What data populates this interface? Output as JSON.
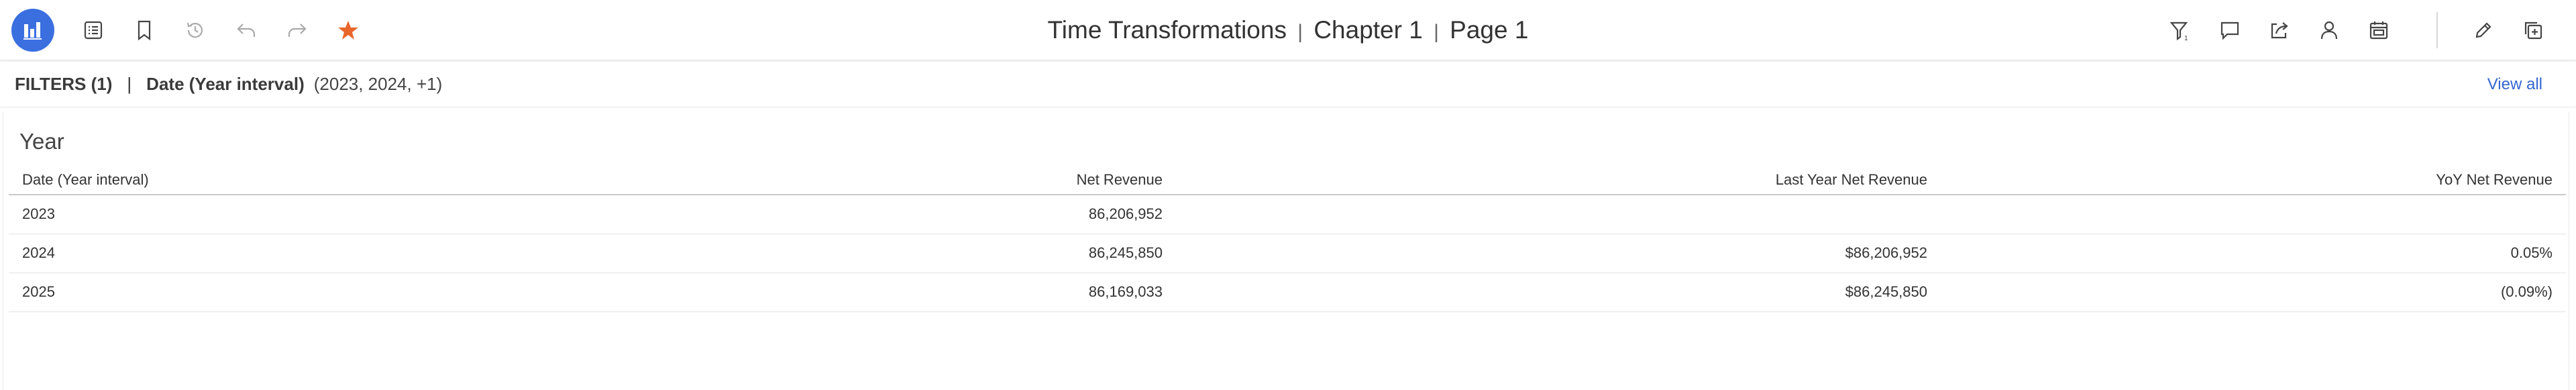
{
  "toolbar": {
    "logo_icon": "bar-chart-app-icon",
    "left_buttons": [
      "table-of-contents-icon",
      "bookmark-icon",
      "history-icon",
      "undo-icon",
      "redo-icon",
      "favorite-star-icon"
    ],
    "title": {
      "workbook": "Time Transformations",
      "chapter": "Chapter 1",
      "page": "Page 1",
      "separator": "|"
    },
    "right_buttons": [
      "filter-icon",
      "comment-icon",
      "share-icon",
      "user-icon",
      "calendar-icon",
      "edit-icon",
      "duplicate-icon"
    ],
    "filter_badge": "1",
    "colors": {
      "accent": "#3b6fe0",
      "star": "#e8662a"
    }
  },
  "filters": {
    "count_label": "FILTERS (1)",
    "separator": "|",
    "name": "Date (Year interval)",
    "value": "(2023, 2024, +1)",
    "view_all": "View all"
  },
  "widget": {
    "title": "Year",
    "columns": [
      "Date (Year interval)",
      "Net Revenue",
      "Last Year Net Revenue",
      "YoY Net Revenue"
    ],
    "rows": [
      [
        "2023",
        "86,206,952",
        "",
        ""
      ],
      [
        "2024",
        "86,245,850",
        "$86,206,952",
        "0.05%"
      ],
      [
        "2025",
        "86,169,033",
        "$86,245,850",
        "(0.09%)"
      ]
    ]
  }
}
